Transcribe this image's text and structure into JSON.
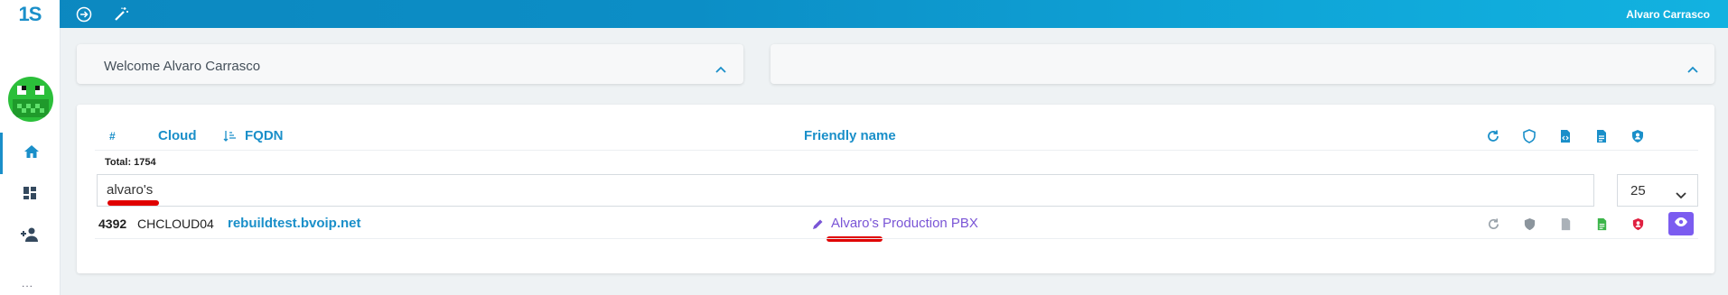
{
  "topbar": {
    "logo_text": "1S",
    "user_name": "Alvaro Carrasco",
    "icons": [
      "arrow-circle-right-icon",
      "magic-wand-icon"
    ]
  },
  "sidebar": {
    "avatar": "avatar",
    "items": [
      {
        "icon": "home-icon",
        "active": true
      },
      {
        "icon": "dashboard-icon",
        "active": false
      },
      {
        "icon": "add-user-icon",
        "active": false
      }
    ],
    "more": "..."
  },
  "welcome": {
    "text": "Welcome Alvaro Carrasco"
  },
  "table": {
    "columns": {
      "id": "#",
      "cloud": "Cloud",
      "fqdn": "FQDN",
      "friendly_name": "Friendly name"
    },
    "header_icons": [
      "refresh-icon",
      "shield-icon",
      "file-code-icon",
      "file-text-icon",
      "user-shield-icon"
    ],
    "total": "Total: 1754",
    "search": {
      "value": "alvaro's",
      "placeholder": ""
    },
    "page_size": "25",
    "rows": [
      {
        "id": "4392",
        "cloud": "CHCLOUD04",
        "fqdn": "rebuildtest.bvoip.net",
        "friendly_name": "Alvaro's Production PBX"
      }
    ]
  },
  "colors": {
    "accent": "#1a8fc9",
    "friendly": "#7a55d6",
    "view_button": "#7b5cf0",
    "annotation_red": "#e00000"
  }
}
